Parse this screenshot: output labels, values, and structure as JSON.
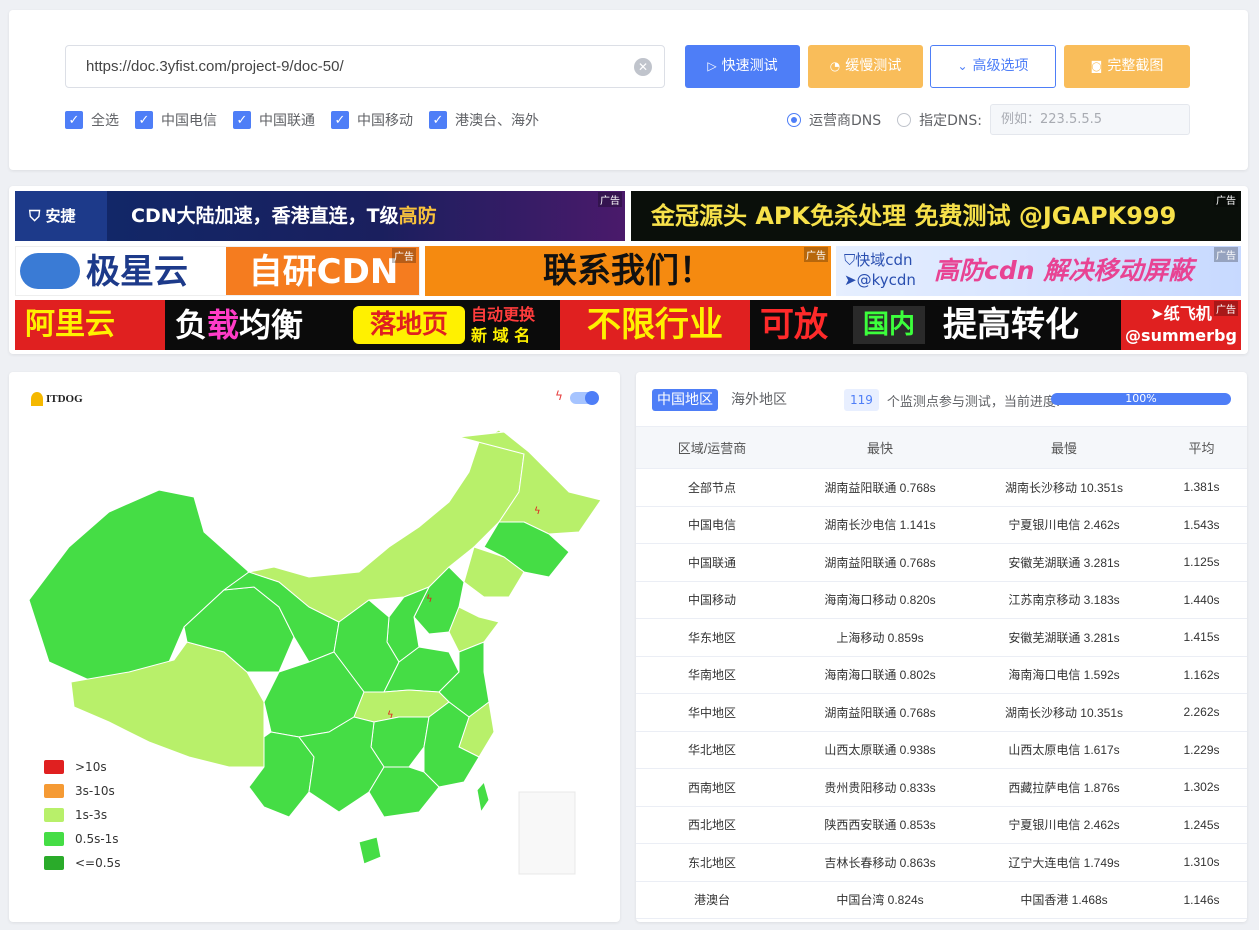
{
  "toolbar": {
    "url": "https://doc.3yfist.com/project-9/doc-50/",
    "quick_test": "快速测试",
    "slow_test": "缓慢测试",
    "advanced": "高级选项",
    "screenshot": "完整截图"
  },
  "filters": {
    "all": "全选",
    "telecom": "中国电信",
    "unicom": "中国联通",
    "mobile": "中国移动",
    "hkmo": "港澳台、海外"
  },
  "dns": {
    "isp": "运营商DNS",
    "custom": "指定DNS:",
    "placeholder": "例如：223.5.5.5"
  },
  "ads": {
    "tag": "广告",
    "ad1_brand": "安捷",
    "ad1": "CDN大陆加速，香港直连，T级",
    "ad1_hl": "高防",
    "ad2": "金冠源头 APK免杀处理 免费测试 @JGAPK999",
    "ad3_brand": "极星云",
    "ad3": "自研CDN",
    "ad4": "联系我们！",
    "ad5_brand": "快域cdn",
    "ad5_handle": "@kycdn",
    "ad5": "高防cdn 解决移动屏蔽",
    "ad6_a": "阿里云",
    "ad6_b": "负",
    "ad6_c": "载",
    "ad6_d": "均衡",
    "ad6_e": "落地页",
    "ad6_f": "自动更换",
    "ad6_g": "新 域 名",
    "ad6_h": "不限行业",
    "ad6_i": "可放",
    "ad6_j": "国内",
    "ad6_k": "提高转化",
    "ad6_l": "纸飞机",
    "ad6_m": "@summerbg"
  },
  "map": {
    "logo": "ITDOG",
    "legend": [
      {
        "label": ">10s",
        "color": "#e02020"
      },
      {
        "label": "3s-10s",
        "color": "#f59a34"
      },
      {
        "label": "1s-3s",
        "color": "#b8f06a"
      },
      {
        "label": "0.5s-1s",
        "color": "#45dd45"
      },
      {
        "label": "<=0.5s",
        "color": "#2aab2a"
      }
    ]
  },
  "results": {
    "tab_cn": "中国地区",
    "tab_overseas": "海外地区",
    "count": "119",
    "count_text": "个监测点参与测试，当前进度:",
    "progress": "100%",
    "headers": [
      "区域/运营商",
      "最快",
      "最慢",
      "平均"
    ],
    "rows": [
      [
        "全部节点",
        "湖南益阳联通 0.768s",
        "湖南长沙移动 10.351s",
        "1.381s"
      ],
      [
        "中国电信",
        "湖南长沙电信 1.141s",
        "宁夏银川电信 2.462s",
        "1.543s"
      ],
      [
        "中国联通",
        "湖南益阳联通 0.768s",
        "安徽芜湖联通 3.281s",
        "1.125s"
      ],
      [
        "中国移动",
        "海南海口移动 0.820s",
        "江苏南京移动 3.183s",
        "1.440s"
      ],
      [
        "华东地区",
        "上海移动 0.859s",
        "安徽芜湖联通 3.281s",
        "1.415s"
      ],
      [
        "华南地区",
        "海南海口联通 0.802s",
        "海南海口电信 1.592s",
        "1.162s"
      ],
      [
        "华中地区",
        "湖南益阳联通 0.768s",
        "湖南长沙移动 10.351s",
        "2.262s"
      ],
      [
        "华北地区",
        "山西太原联通 0.938s",
        "山西太原电信 1.617s",
        "1.229s"
      ],
      [
        "西南地区",
        "贵州贵阳移动 0.833s",
        "西藏拉萨电信 1.876s",
        "1.302s"
      ],
      [
        "西北地区",
        "陕西西安联通 0.853s",
        "宁夏银川电信 2.462s",
        "1.245s"
      ],
      [
        "东北地区",
        "吉林长春移动 0.863s",
        "辽宁大连电信 1.749s",
        "1.310s"
      ],
      [
        "港澳台",
        "中国台湾 0.824s",
        "中国香港 1.468s",
        "1.146s"
      ]
    ]
  }
}
